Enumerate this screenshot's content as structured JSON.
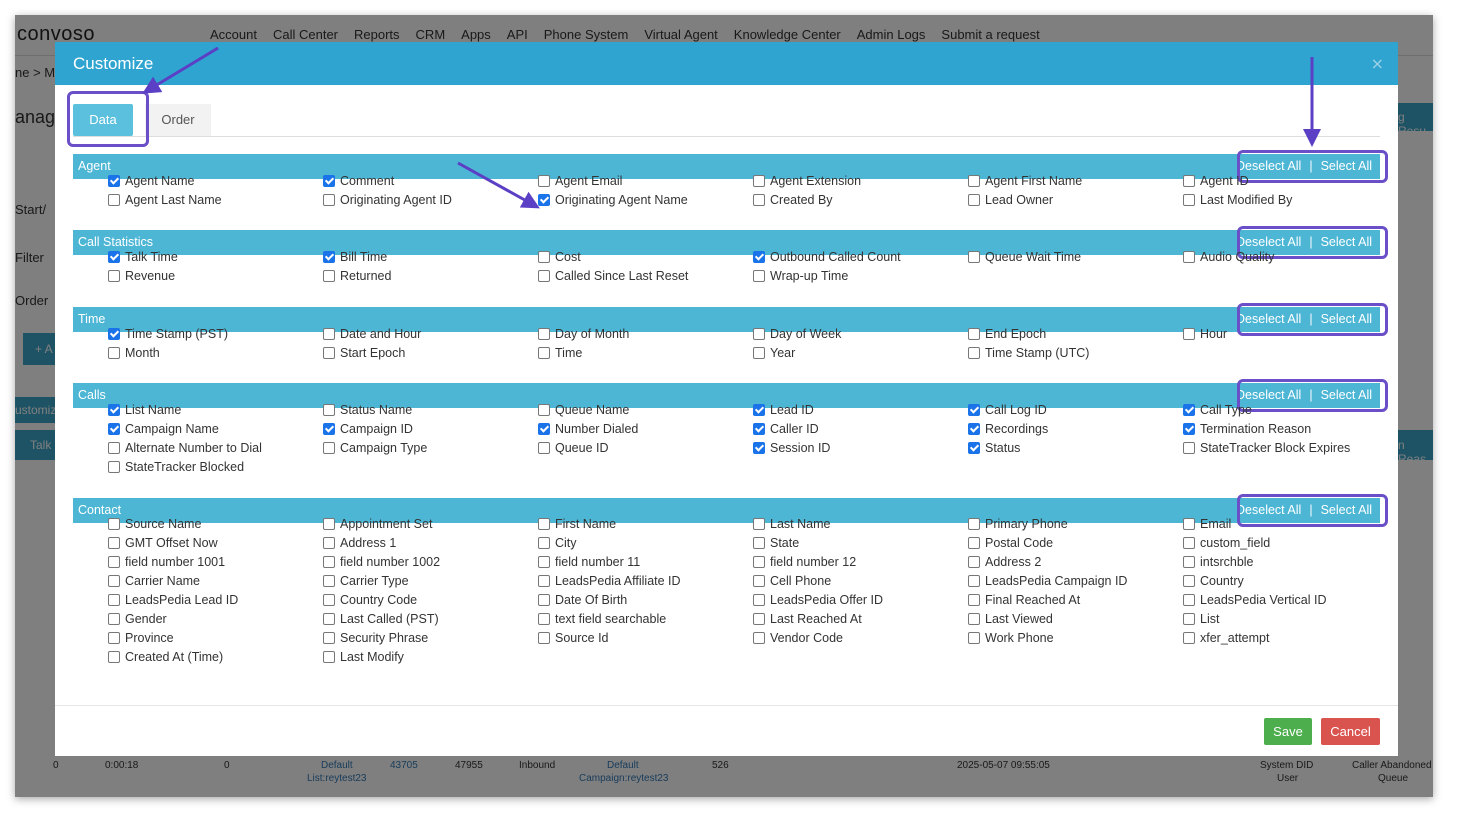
{
  "app": {
    "logo": "convoso",
    "nav": [
      "Account",
      "Call Center",
      "Reports",
      "CRM",
      "Apps",
      "API",
      "Phone System",
      "Virtual Agent",
      "Knowledge Center",
      "Admin Logs",
      "Submit a request"
    ],
    "breadcrumb": "ne > Ma",
    "page_title_partial": "anage",
    "left_labels": [
      "Start/",
      "Filter",
      "Order"
    ],
    "add_partial": "+ A",
    "customize_partial": "ustomiz",
    "talk_partial": "Talk",
    "right_partial": "g Resu",
    "right_col_partial": "n Reas",
    "footer_row": {
      "c1": "0",
      "c2": "0:00:18",
      "c3": "0",
      "c4a": "Default",
      "c4b": "List:reytest23",
      "c5": "43705",
      "c6": "47955",
      "c7": "Inbound",
      "c8a": "Default",
      "c8b": "Campaign:reytest23",
      "c9": "526",
      "c10": "2025-05-07 09:55:05",
      "c11a": "System DID",
      "c11b": "User",
      "c12a": "Caller Abandoned",
      "c12b": "Queue"
    }
  },
  "modal": {
    "title": "Customize",
    "close": "×",
    "tabs": {
      "data": "Data",
      "order": "Order"
    },
    "deselect_label": "Deselect All",
    "separator": "|",
    "select_label": "Select All",
    "sections": [
      {
        "title": "Agent",
        "items": [
          {
            "label": "Agent Name",
            "checked": true
          },
          {
            "label": "Comment",
            "checked": true
          },
          {
            "label": "Agent Email",
            "checked": false
          },
          {
            "label": "Agent Extension",
            "checked": false
          },
          {
            "label": "Agent First Name",
            "checked": false
          },
          {
            "label": "Agent ID",
            "checked": false
          },
          {
            "label": "Agent Last Name",
            "checked": false
          },
          {
            "label": "Originating Agent ID",
            "checked": false
          },
          {
            "label": "Originating Agent Name",
            "checked": true
          },
          {
            "label": "Created By",
            "checked": false
          },
          {
            "label": "Lead Owner",
            "checked": false
          },
          {
            "label": "Last Modified By",
            "checked": false
          }
        ]
      },
      {
        "title": "Call Statistics",
        "items": [
          {
            "label": "Talk Time",
            "checked": true
          },
          {
            "label": "Bill Time",
            "checked": true
          },
          {
            "label": "Cost",
            "checked": false
          },
          {
            "label": "Outbound Called Count",
            "checked": true
          },
          {
            "label": "Queue Wait Time",
            "checked": false
          },
          {
            "label": "Audio Quality",
            "checked": false
          },
          {
            "label": "Revenue",
            "checked": false
          },
          {
            "label": "Returned",
            "checked": false
          },
          {
            "label": "Called Since Last Reset",
            "checked": false
          },
          {
            "label": "Wrap-up Time",
            "checked": false
          }
        ]
      },
      {
        "title": "Time",
        "items": [
          {
            "label": "Time Stamp (PST)",
            "checked": true
          },
          {
            "label": "Date and Hour",
            "checked": false
          },
          {
            "label": "Day of Month",
            "checked": false
          },
          {
            "label": "Day of Week",
            "checked": false
          },
          {
            "label": "End Epoch",
            "checked": false
          },
          {
            "label": "Hour",
            "checked": false
          },
          {
            "label": "Month",
            "checked": false
          },
          {
            "label": "Start Epoch",
            "checked": false
          },
          {
            "label": "Time",
            "checked": false
          },
          {
            "label": "Year",
            "checked": false
          },
          {
            "label": "Time Stamp (UTC)",
            "checked": false
          }
        ]
      },
      {
        "title": "Calls",
        "items": [
          {
            "label": "List Name",
            "checked": true
          },
          {
            "label": "Status Name",
            "checked": false
          },
          {
            "label": "Queue Name",
            "checked": false
          },
          {
            "label": "Lead ID",
            "checked": true
          },
          {
            "label": "Call Log ID",
            "checked": true
          },
          {
            "label": "Call Type",
            "checked": true
          },
          {
            "label": "Campaign Name",
            "checked": true
          },
          {
            "label": "Campaign ID",
            "checked": true
          },
          {
            "label": "Number Dialed",
            "checked": true
          },
          {
            "label": "Caller ID",
            "checked": true
          },
          {
            "label": "Recordings",
            "checked": true
          },
          {
            "label": "Termination Reason",
            "checked": true
          },
          {
            "label": "Alternate Number to Dial",
            "checked": false
          },
          {
            "label": "Campaign Type",
            "checked": false
          },
          {
            "label": "Queue ID",
            "checked": false
          },
          {
            "label": "Session ID",
            "checked": true
          },
          {
            "label": "Status",
            "checked": true
          },
          {
            "label": "StateTracker Block Expires",
            "checked": false
          },
          {
            "label": "StateTracker Blocked",
            "checked": false
          }
        ]
      },
      {
        "title": "Contact",
        "items": [
          {
            "label": "Source Name",
            "checked": false
          },
          {
            "label": "Appointment Set",
            "checked": false
          },
          {
            "label": "First Name",
            "checked": false
          },
          {
            "label": "Last Name",
            "checked": false
          },
          {
            "label": "Primary Phone",
            "checked": false
          },
          {
            "label": "Email",
            "checked": false
          },
          {
            "label": "GMT Offset Now",
            "checked": false
          },
          {
            "label": "Address 1",
            "checked": false
          },
          {
            "label": "City",
            "checked": false
          },
          {
            "label": "State",
            "checked": false
          },
          {
            "label": "Postal Code",
            "checked": false
          },
          {
            "label": "custom_field",
            "checked": false
          },
          {
            "label": "field number 1001",
            "checked": false
          },
          {
            "label": "field number 1002",
            "checked": false
          },
          {
            "label": "field number 11",
            "checked": false
          },
          {
            "label": "field number 12",
            "checked": false
          },
          {
            "label": "Address 2",
            "checked": false
          },
          {
            "label": "intsrchble",
            "checked": false
          },
          {
            "label": "Carrier Name",
            "checked": false
          },
          {
            "label": "Carrier Type",
            "checked": false
          },
          {
            "label": "LeadsPedia Affiliate ID",
            "checked": false
          },
          {
            "label": "Cell Phone",
            "checked": false
          },
          {
            "label": "LeadsPedia Campaign ID",
            "checked": false
          },
          {
            "label": "Country",
            "checked": false
          },
          {
            "label": "LeadsPedia Lead ID",
            "checked": false
          },
          {
            "label": "Country Code",
            "checked": false
          },
          {
            "label": "Date Of Birth",
            "checked": false
          },
          {
            "label": "LeadsPedia Offer ID",
            "checked": false
          },
          {
            "label": "Final Reached At",
            "checked": false
          },
          {
            "label": "LeadsPedia Vertical ID",
            "checked": false
          },
          {
            "label": "Gender",
            "checked": false
          },
          {
            "label": "Last Called (PST)",
            "checked": false
          },
          {
            "label": "text field searchable",
            "checked": false
          },
          {
            "label": "Last Reached At",
            "checked": false
          },
          {
            "label": "Last Viewed",
            "checked": false
          },
          {
            "label": "List",
            "checked": false
          },
          {
            "label": "Province",
            "checked": false
          },
          {
            "label": "Security Phrase",
            "checked": false
          },
          {
            "label": "Source Id",
            "checked": false
          },
          {
            "label": "Vendor Code",
            "checked": false
          },
          {
            "label": "Work Phone",
            "checked": false
          },
          {
            "label": "xfer_attempt",
            "checked": false
          },
          {
            "label": "Created At (Time)",
            "checked": false
          },
          {
            "label": "Last Modify",
            "checked": false
          }
        ]
      }
    ],
    "save": "Save",
    "cancel": "Cancel"
  },
  "colors": {
    "header": "#2fa4d0",
    "section": "#4db6d5",
    "highlight": "#6a4fc8",
    "save": "#4cae4c",
    "cancel": "#d9534f",
    "checkbox": "#1a73e8"
  }
}
